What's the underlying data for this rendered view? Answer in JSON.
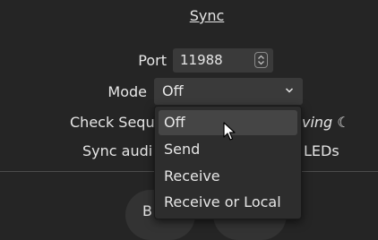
{
  "section": {
    "title": "Sync"
  },
  "port": {
    "label": "Port",
    "value": "11988"
  },
  "mode": {
    "label": "Mode",
    "value": "Off",
    "options": [
      "Off",
      "Send",
      "Receive",
      "Receive or Local"
    ],
    "highlighted_option": "Off"
  },
  "obscured": {
    "check_prefix": "Check Sequ",
    "check_suffix": "ving ☾",
    "sync_prefix": "Sync audi",
    "sync_suffix": "LEDs",
    "bottom_button_fragment": "B"
  },
  "colors": {
    "background": "#252525",
    "field": "#3a3a3a",
    "menu": "#2d2d2d",
    "menu_highlight": "#454545",
    "text": "#e6e6e6"
  }
}
